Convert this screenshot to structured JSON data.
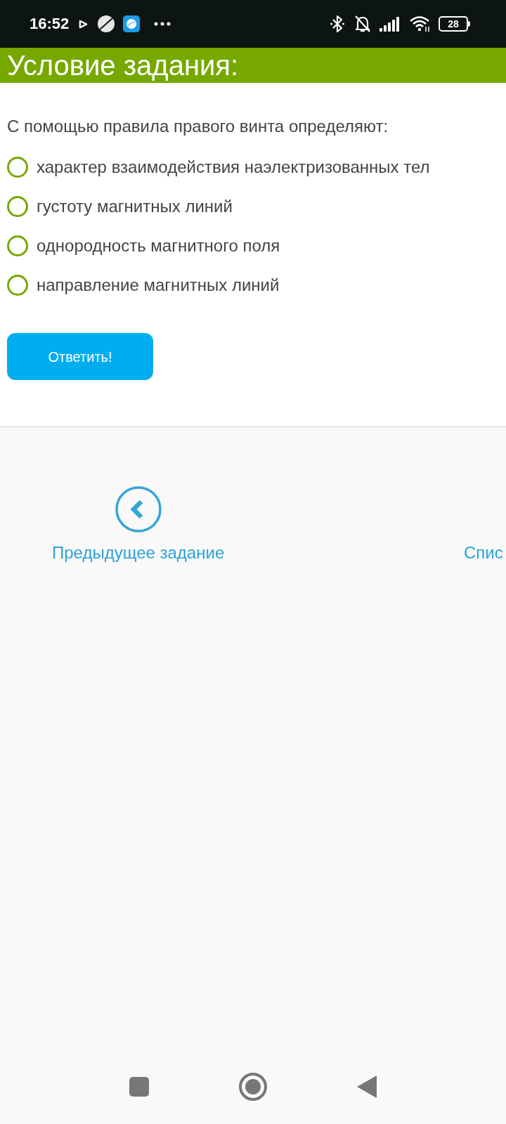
{
  "status_bar": {
    "time": "16:52",
    "battery": "28"
  },
  "header": {
    "title": "Условие задания:"
  },
  "question": {
    "text": "С помощью правила правого винта определяют:",
    "options": [
      {
        "label": "характер взаимодействия наэлектризованных тел",
        "selected": false
      },
      {
        "label": "густоту магнитных линий",
        "selected": false
      },
      {
        "label": "однородность магнитного поля",
        "selected": false
      },
      {
        "label": "направление магнитных линий",
        "selected": false
      }
    ]
  },
  "submit_button": {
    "label": "Ответить!"
  },
  "navigation": {
    "previous": {
      "label": "Предыдущее задание"
    },
    "next": {
      "label": "Спис"
    }
  }
}
